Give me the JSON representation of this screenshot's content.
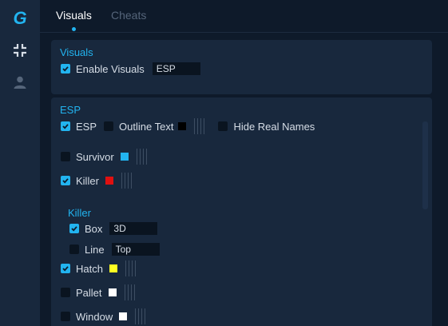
{
  "tabs": [
    {
      "label": "Visuals",
      "active": true
    },
    {
      "label": "Cheats",
      "active": false
    }
  ],
  "sidebar": {
    "logo": "G",
    "icons": [
      "compress-icon",
      "user-icon"
    ]
  },
  "visuals_panel": {
    "title": "Visuals",
    "enable_visuals": {
      "label": "Enable Visuals",
      "checked": true
    },
    "mode_value": "ESP"
  },
  "esp_panel": {
    "title": "ESP",
    "esp": {
      "label": "ESP",
      "checked": true
    },
    "outline_text": {
      "label": "Outline Text",
      "checked": false,
      "color": "#000000"
    },
    "hide_real_names": {
      "label": "Hide Real Names",
      "checked": false
    },
    "survivor": {
      "label": "Survivor",
      "checked": false,
      "color": "#22b4f0"
    },
    "killer": {
      "label": "Killer",
      "checked": true,
      "color": "#e01010"
    },
    "killer_section": {
      "title": "Killer",
      "box": {
        "label": "Box",
        "checked": true,
        "value": "3D"
      },
      "line": {
        "label": "Line",
        "checked": false,
        "value": "Top"
      }
    },
    "hatch": {
      "label": "Hatch",
      "checked": true,
      "color": "#ffff22"
    },
    "pallet": {
      "label": "Pallet",
      "checked": false,
      "color": "#ffffff"
    },
    "window": {
      "label": "Window",
      "checked": false,
      "color": "#ffffff"
    }
  },
  "colors": {
    "accent": "#22b4f0",
    "panel": "#18283d",
    "background": "#0e1a2a"
  }
}
